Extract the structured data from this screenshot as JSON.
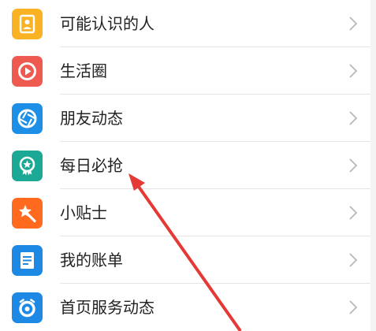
{
  "items": [
    {
      "label": "可能认识的人",
      "icon": "contacts-icon",
      "color": "#F9B223"
    },
    {
      "label": "生活圈",
      "icon": "play-circle-icon",
      "color": "#EE5A4F"
    },
    {
      "label": "朋友动态",
      "icon": "shutter-icon",
      "color": "#1E8FE6"
    },
    {
      "label": "每日必抢",
      "icon": "badge-star-icon",
      "color": "#1BA995"
    },
    {
      "label": "小贴士",
      "icon": "magic-wand-star-icon",
      "color": "#FF6A1E"
    },
    {
      "label": "我的账单",
      "icon": "bill-document-icon",
      "color": "#1E88E5"
    },
    {
      "label": "首页服务动态",
      "icon": "alarm-clock-icon",
      "color": "#1E88E5"
    }
  ],
  "annotation": {
    "type": "red-arrow",
    "color": "#E53935",
    "points_to": "每日必抢"
  },
  "colors": {
    "chevron": "#B8B8B8",
    "divider": "#E6E6E6",
    "text": "#222222"
  }
}
